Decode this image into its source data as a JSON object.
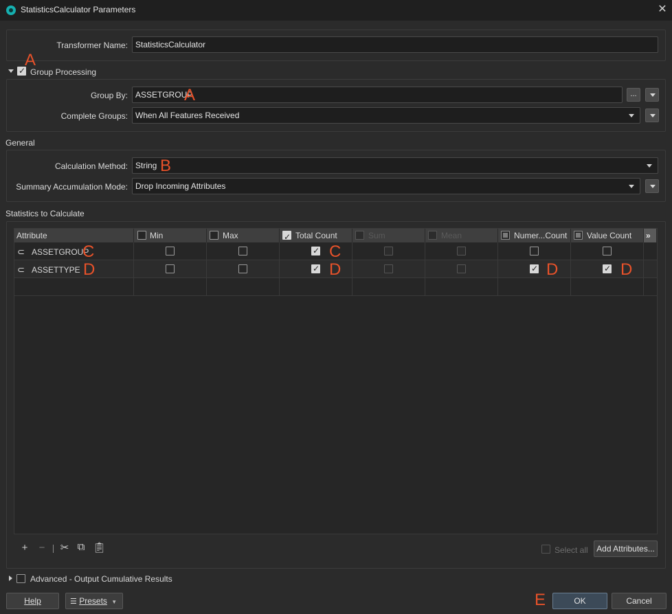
{
  "window": {
    "title": "StatisticsCalculator Parameters"
  },
  "transformer": {
    "label": "Transformer Name:",
    "value": "StatisticsCalculator"
  },
  "group_processing": {
    "label": "Group Processing",
    "group_by_label": "Group By:",
    "group_by_value": "ASSETGROUP",
    "ellipsis_label": "...",
    "complete_groups_label": "Complete Groups:",
    "complete_groups_value": "When All Features Received"
  },
  "general": {
    "title": "General",
    "calc_method_label": "Calculation Method:",
    "calc_method_value": "String",
    "accum_mode_label": "Summary Accumulation Mode:",
    "accum_mode_value": "Drop Incoming Attributes"
  },
  "stats": {
    "title": "Statistics to Calculate",
    "columns": [
      "Attribute",
      "Min",
      "Max",
      "Total Count",
      "Sum",
      "Mean",
      "Numer...Count",
      "Value Count"
    ],
    "rows": [
      {
        "attribute": "ASSETGROUP"
      },
      {
        "attribute": "ASSETTYPE"
      }
    ],
    "select_all_label": "Select all",
    "add_attributes_label": "Add Attributes..."
  },
  "advanced": {
    "label": "Advanced - Output Cumulative Results"
  },
  "footer": {
    "help": "Help",
    "presets": "Presets",
    "ok": "OK",
    "cancel": "Cancel"
  },
  "annotations": {
    "a": "A",
    "b": "B",
    "c": "C",
    "d": "D",
    "e": "E"
  },
  "colors": {
    "annotation": "#e8522a",
    "background": "#2b2b2b",
    "accent": "#16b0b0"
  }
}
